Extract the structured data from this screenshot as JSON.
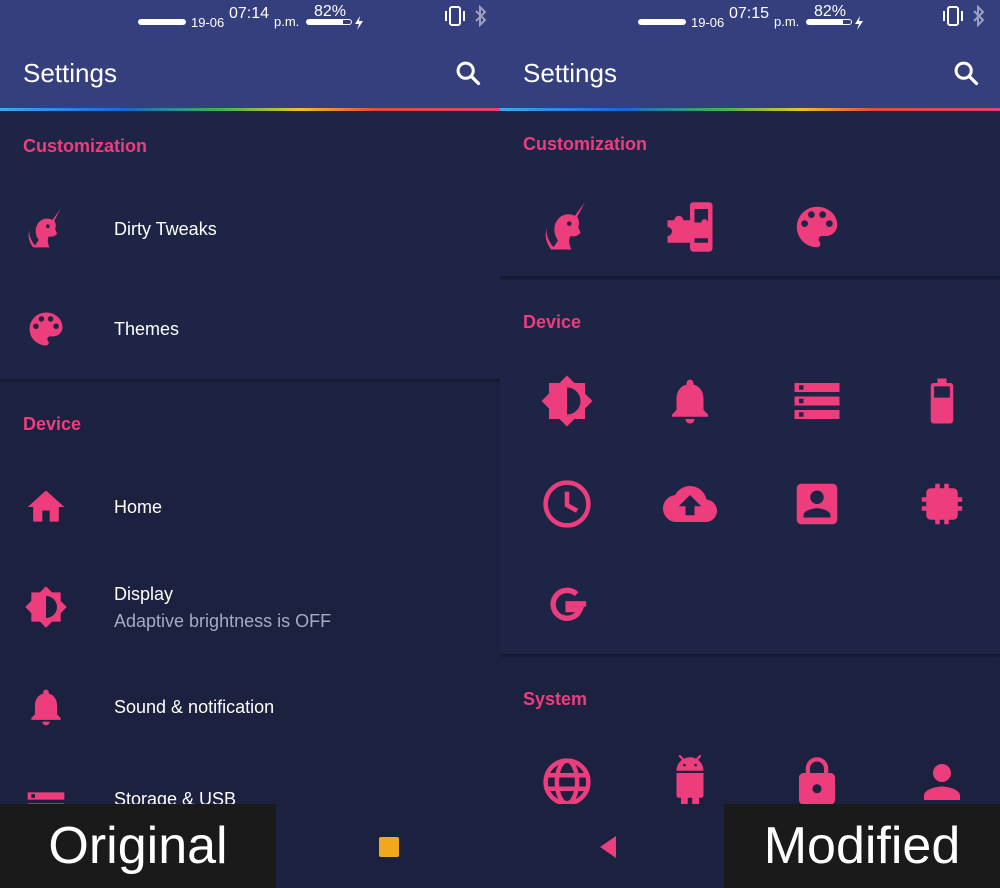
{
  "accent_color": "#ee3d7c",
  "appbar_color": "#353f7e",
  "background_color": "#1c2140",
  "left": {
    "status": {
      "date": "19-06",
      "time": "07:14",
      "ampm": "p.m.",
      "battery": "82%",
      "battery_level": 0.82
    },
    "title": "Settings",
    "sections": [
      {
        "title": "Customization",
        "items": [
          {
            "label": "Dirty Tweaks",
            "icon": "unicorn-icon"
          },
          {
            "label": "Themes",
            "icon": "palette-icon"
          }
        ]
      },
      {
        "title": "Device",
        "items": [
          {
            "label": "Home",
            "icon": "home-icon"
          },
          {
            "label": "Display",
            "sub": "Adaptive brightness is OFF",
            "icon": "brightness-icon"
          },
          {
            "label": "Sound & notification",
            "icon": "bell-icon"
          },
          {
            "label": "Storage & USB",
            "icon": "storage-icon"
          }
        ]
      }
    ]
  },
  "right": {
    "status": {
      "date": "19-06",
      "time": "07:15",
      "ampm": "p.m.",
      "battery": "82%",
      "battery_level": 0.82
    },
    "title": "Settings",
    "sections": [
      {
        "title": "Customization",
        "icons": [
          "unicorn-icon",
          "puzzle-phone-icon",
          "palette-icon"
        ]
      },
      {
        "title": "Device",
        "icons": [
          "brightness-icon",
          "bell-icon",
          "storage-icon",
          "battery-icon",
          "clock-icon",
          "cloud-upload-icon",
          "account-box-icon",
          "memory-chip-icon",
          "google-icon"
        ]
      },
      {
        "title": "System",
        "icons": [
          "globe-icon",
          "android-icon",
          "lock-icon",
          "person-icon"
        ]
      }
    ]
  },
  "overlay": {
    "left_label": "Original",
    "right_label": "Modified"
  },
  "navbar": {
    "icons": [
      "recents-icon",
      "back-icon"
    ]
  }
}
